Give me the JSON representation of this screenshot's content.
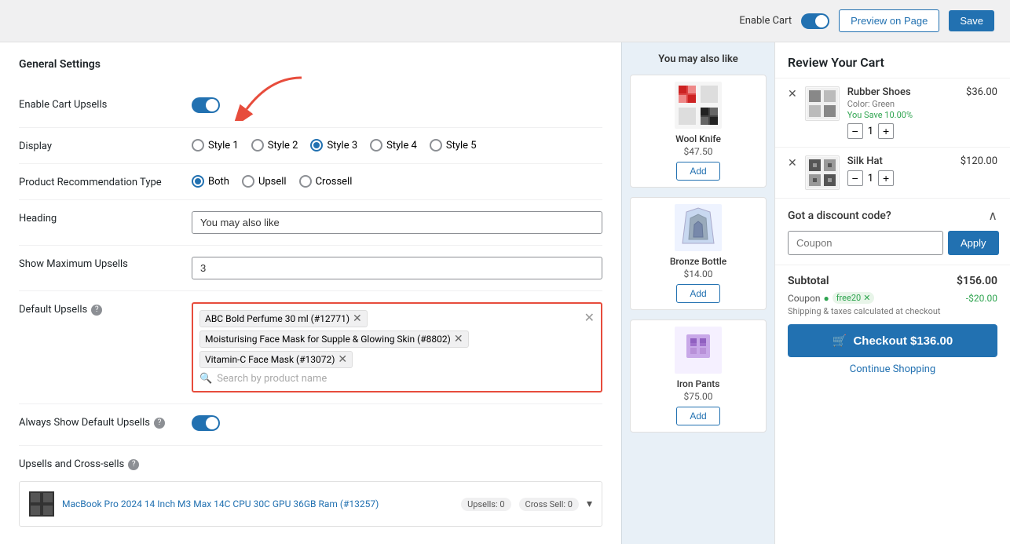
{
  "topbar": {
    "enable_cart_label": "Enable Cart",
    "preview_button": "Preview on Page",
    "save_button": "Save"
  },
  "general_settings": {
    "title": "General Settings",
    "enable_cart_upsells_label": "Enable Cart Upsells",
    "display_label": "Display",
    "display_options": [
      "Style 1",
      "Style 2",
      "Style 3",
      "Style 4",
      "Style 5"
    ],
    "display_selected": 2,
    "product_recommendation_label": "Product Recommendation Type",
    "recommendation_options": [
      "Both",
      "Upsell",
      "Crossell"
    ],
    "recommendation_selected": 0,
    "heading_label": "Heading",
    "heading_value": "You may also like",
    "show_max_label": "Show Maximum Upsells",
    "show_max_value": "3",
    "default_upsells_label": "Default Upsells",
    "always_show_label": "Always Show Default Upsells",
    "upsells_crossells_label": "Upsells and Cross-sells"
  },
  "tags": [
    {
      "text": "ABC Bold Perfume 30 ml (#12771)",
      "removable": true
    },
    {
      "text": "Moisturising Face Mask for Supple & Glowing Skin (#8802)",
      "removable": true
    },
    {
      "text": "Vitamin-C Face Mask (#13072)",
      "removable": true
    }
  ],
  "search_placeholder": "Search by product name",
  "product_row": {
    "name": "MacBook Pro 2024 14 Inch M3 Max 14C CPU 30C GPU 36GB Ram (#13257)",
    "upsells": "Upsells: 0",
    "cross_sell": "Cross Sell: 0"
  },
  "sidebar": {
    "title": "You may also like",
    "products": [
      {
        "name": "Wool Knife",
        "price": "$47.50",
        "add_label": "Add"
      },
      {
        "name": "Bronze Bottle",
        "price": "$14.00",
        "add_label": "Add"
      },
      {
        "name": "Iron Pants",
        "price": "$75.00",
        "add_label": "Add"
      }
    ]
  },
  "cart": {
    "title": "Review Your Cart",
    "items": [
      {
        "name": "Rubber Shoes",
        "meta": "Color: Green",
        "save": "You Save 10.00%",
        "price": "$36.00",
        "qty": 1
      },
      {
        "name": "Silk Hat",
        "meta": "",
        "save": "",
        "price": "$120.00",
        "qty": 1
      }
    ],
    "discount_title": "Got a discount code?",
    "coupon_placeholder": "Coupon",
    "apply_button": "Apply",
    "subtotal_label": "Subtotal",
    "subtotal_amount": "$156.00",
    "coupon_label": "Coupon",
    "coupon_code": "free20",
    "coupon_discount": "-$20.00",
    "shipping_note": "Shipping & taxes calculated at checkout",
    "checkout_label": "Checkout $136.00",
    "continue_label": "Continue Shopping"
  }
}
